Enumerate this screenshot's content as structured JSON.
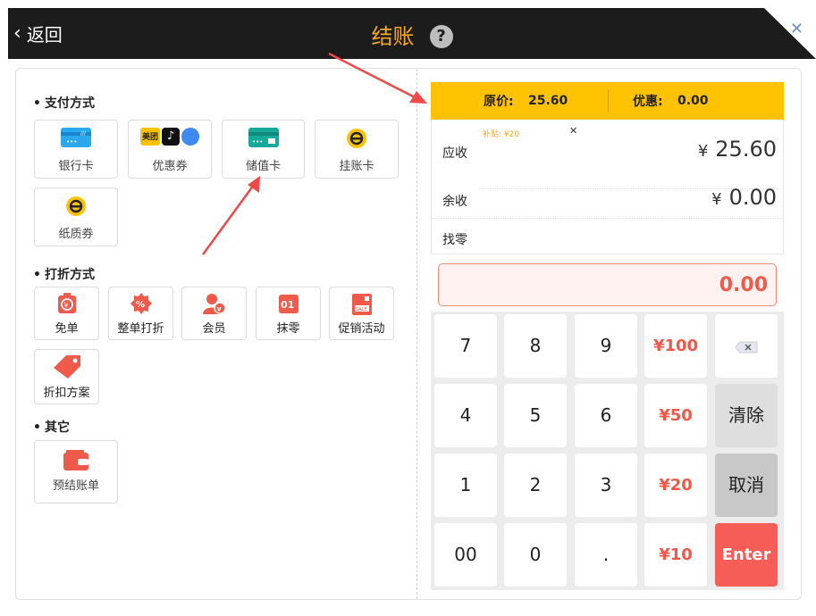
{
  "header": {
    "back_label": "返回",
    "title": "结账",
    "help_icon": "?"
  },
  "payment": {
    "title": "支付方式",
    "items": [
      {
        "label": "银行卡",
        "icon": "bank-card-icon"
      },
      {
        "label": "优惠券",
        "icon": "coupon-icon"
      },
      {
        "label": "储值卡",
        "icon": "stored-value-card-icon"
      },
      {
        "label": "挂账卡",
        "icon": "credit-account-icon"
      },
      {
        "label": "纸质券",
        "icon": "paper-voucher-icon"
      }
    ],
    "coupon_logo_text": "美团"
  },
  "discount": {
    "title": "打折方式",
    "items": [
      {
        "label": "免单",
        "icon": "free-order-icon"
      },
      {
        "label": "整单打折",
        "icon": "whole-order-discount-icon"
      },
      {
        "label": "会员",
        "icon": "member-icon"
      },
      {
        "label": "抹零",
        "icon": "round-off-icon"
      },
      {
        "label": "促销活动",
        "icon": "promotion-icon"
      },
      {
        "label": "折扣方案",
        "icon": "discount-plan-icon"
      }
    ]
  },
  "other": {
    "title": "其它",
    "items": [
      {
        "label": "预结账单",
        "icon": "pre-bill-icon"
      }
    ]
  },
  "summary": {
    "original_label": "原价:",
    "original_value": "25.60",
    "discount_label": "优惠:",
    "discount_value": "0.00",
    "subsidy_tag": "补贴: ¥20",
    "receivable_label": "应收",
    "receivable_value": "25.60",
    "remaining_label": "余收",
    "remaining_value": "0.00",
    "change_label": "找零",
    "currency": "¥"
  },
  "amount_input": {
    "value": "0.00"
  },
  "keypad": {
    "keys": [
      "7",
      "8",
      "9",
      "4",
      "5",
      "6",
      "1",
      "2",
      "3",
      "00",
      "0",
      "."
    ],
    "quick": [
      "¥100",
      "¥50",
      "¥20",
      "¥10"
    ],
    "clear": "清除",
    "cancel": "取消",
    "enter": "Enter"
  },
  "colors": {
    "accent": "#ffc200",
    "danger": "#f65d56",
    "title": "#f5a623"
  }
}
